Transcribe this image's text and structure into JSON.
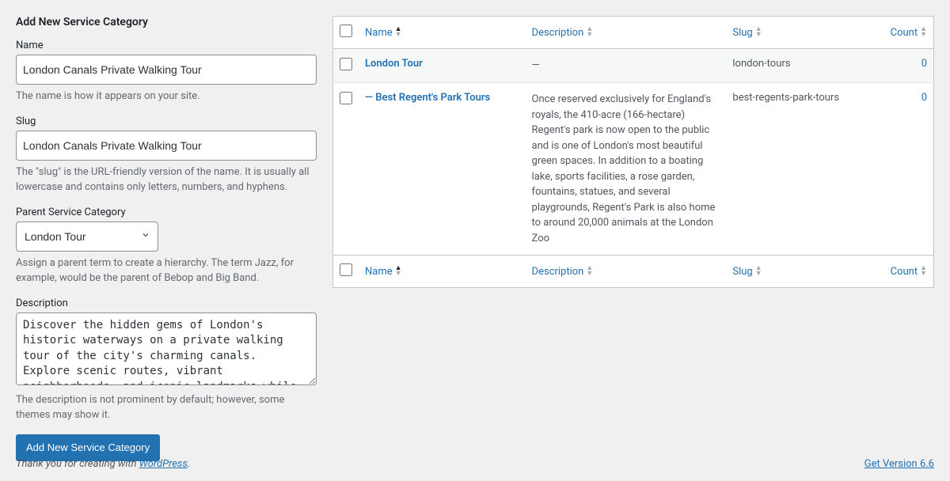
{
  "form": {
    "heading": "Add New Service Category",
    "name": {
      "label": "Name",
      "value": "London Canals Private Walking Tour",
      "help": "The name is how it appears on your site."
    },
    "slug": {
      "label": "Slug",
      "value": "London Canals Private Walking Tour",
      "help": "The \"slug\" is the URL-friendly version of the name. It is usually all lowercase and contains only letters, numbers, and hyphens."
    },
    "parent": {
      "label": "Parent Service Category",
      "selected": "London Tour",
      "help": "Assign a parent term to create a hierarchy. The term Jazz, for example, would be the parent of Bebop and Big Band."
    },
    "description": {
      "label": "Description",
      "value": "Discover the hidden gems of London's historic waterways on a private walking tour of the city's charming canals. Explore scenic routes, vibrant neighborhoods, and iconic landmarks while learning about the rich history and culture that shaped these unique urban landscapes. Perfect for those seeking a",
      "help": "The description is not prominent by default; however, some themes may show it."
    },
    "submit": "Add New Service Category"
  },
  "table": {
    "cols": {
      "name": "Name",
      "description": "Description",
      "slug": "Slug",
      "count": "Count"
    },
    "rows": [
      {
        "name": "London Tour",
        "prefix": "",
        "description": "—",
        "slug": "london-tours",
        "count": "0"
      },
      {
        "name": "Best Regent's Park Tours",
        "prefix": "— ",
        "description": "Once reserved exclusively for England's royals, the 410-acre (166-hectare) Regent's park is now open to the public and is one of London's most beautiful green spaces. In addition to a boating lake, sports facilities, a rose garden, fountains, statues, and several playgrounds, Regent's Park is also home to around 20,000 animals at the London Zoo",
        "slug": "best-regents-park-tours",
        "count": "0"
      }
    ]
  },
  "footer": {
    "thanks_pre": "Thank you for creating with ",
    "wp": "WordPress",
    "thanks_post": ".",
    "version": "Get Version 6.6"
  }
}
